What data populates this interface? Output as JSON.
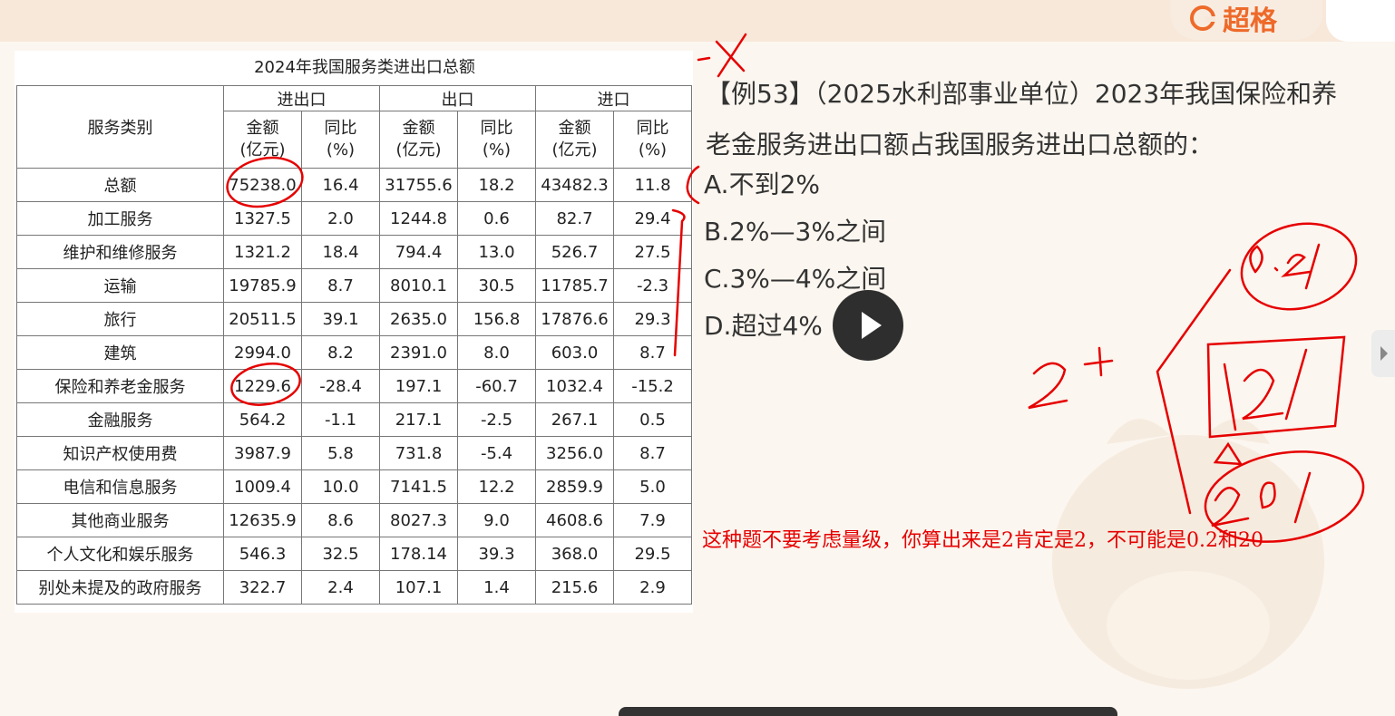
{
  "logo": {
    "text": "超格",
    "color": "#ee6a2a"
  },
  "table": {
    "title": "2024年我国服务类进出口总额",
    "category_header": "服务类别",
    "group_headers": [
      "进出口",
      "出口",
      "进口"
    ],
    "amount_label": "金额\n(亿元)",
    "yoy_label": "同比\n(%)",
    "rows": [
      {
        "cat": "总额",
        "v": [
          "75238.0",
          "16.4",
          "31755.6",
          "18.2",
          "43482.3",
          "11.8"
        ]
      },
      {
        "cat": "加工服务",
        "v": [
          "1327.5",
          "2.0",
          "1244.8",
          "0.6",
          "82.7",
          "29.4"
        ]
      },
      {
        "cat": "维护和维修服务",
        "v": [
          "1321.2",
          "18.4",
          "794.4",
          "13.0",
          "526.7",
          "27.5"
        ]
      },
      {
        "cat": "运输",
        "v": [
          "19785.9",
          "8.7",
          "8010.1",
          "30.5",
          "11785.7",
          "-2.3"
        ]
      },
      {
        "cat": "旅行",
        "v": [
          "20511.5",
          "39.1",
          "2635.0",
          "156.8",
          "17876.6",
          "29.3"
        ]
      },
      {
        "cat": "建筑",
        "v": [
          "2994.0",
          "8.2",
          "2391.0",
          "8.0",
          "603.0",
          "8.7"
        ]
      },
      {
        "cat": "保险和养老金服务",
        "v": [
          "1229.6",
          "-28.4",
          "197.1",
          "-60.7",
          "1032.4",
          "-15.2"
        ]
      },
      {
        "cat": "金融服务",
        "v": [
          "564.2",
          "-1.1",
          "217.1",
          "-2.5",
          "267.1",
          "0.5"
        ]
      },
      {
        "cat": "知识产权使用费",
        "v": [
          "3987.9",
          "5.8",
          "731.8",
          "-5.4",
          "3256.0",
          "8.7"
        ]
      },
      {
        "cat": "电信和信息服务",
        "v": [
          "1009.4",
          "10.0",
          "7141.5",
          "12.2",
          "2859.9",
          "5.0"
        ]
      },
      {
        "cat": "其他商业服务",
        "v": [
          "12635.9",
          "8.6",
          "8027.3",
          "9.0",
          "4608.6",
          "7.9"
        ]
      },
      {
        "cat": "个人文化和娱乐服务",
        "v": [
          "546.3",
          "32.5",
          "178.14",
          "39.3",
          "368.0",
          "29.5"
        ]
      },
      {
        "cat": "别处未提及的政府服务",
        "v": [
          "322.7",
          "2.4",
          "107.1",
          "1.4",
          "215.6",
          "2.9"
        ]
      }
    ]
  },
  "question": {
    "text": "【例53】（2025水利部事业单位）2023年我国保险和养老金服务进出口额占我国服务进出口总额的：",
    "options": [
      "A.不到2%",
      "B.2%—3%之间",
      "C.3%—4%之间",
      "D.超过4%"
    ]
  },
  "note": "这种题不要考虑量级，你算出来是2肯定是2，不可能是0.2和20",
  "colors": {
    "annotation": "#e60000",
    "note": "#e60000"
  },
  "icons": {
    "play": "play-icon",
    "side": "chevron-right-icon"
  }
}
